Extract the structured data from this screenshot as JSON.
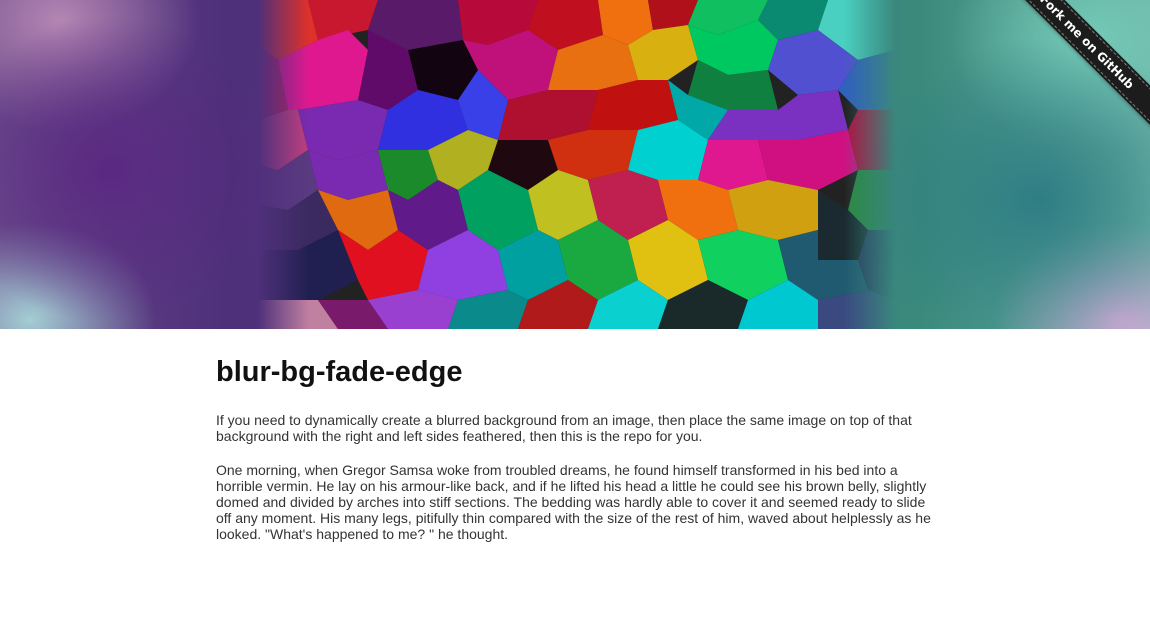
{
  "hero": {
    "image_alt": "colorful voronoi mosaic"
  },
  "ribbon": {
    "label": "Fork me on GitHub"
  },
  "article": {
    "title": "blur-bg-fade-edge",
    "paragraphs": [
      "If you need to dynamically create a blurred background from an image, then place the same image on top of that background with the right and left sides feathered, then this is the repo for you.",
      "One morning, when Gregor Samsa woke from troubled dreams, he found himself transformed in his bed into a horrible vermin. He lay on his armour-like back, and if he lifted his head a little he could see his brown belly, slightly domed and divided by arches into stiff sections. The bedding was hardly able to cover it and seemed ready to slide off any moment. His many legs, pitifully thin compared with the size of the rest of him, waved about helplessly as he looked. \"What's happened to me? \" he thought."
    ]
  },
  "colors": {
    "ribbon_bg": "#1c1c1c",
    "title": "#111111",
    "body_text": "#333333"
  }
}
